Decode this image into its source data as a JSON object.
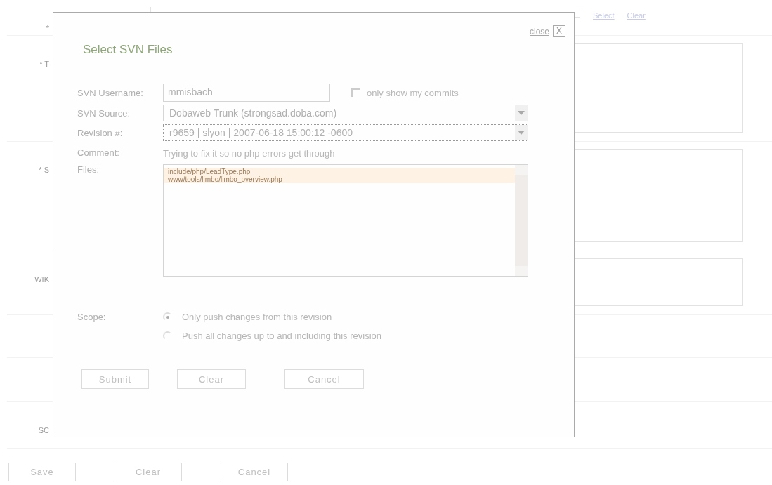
{
  "background_form": {
    "rows": [
      {
        "label": "*",
        "kind": "input",
        "links": [
          "Select",
          "Clear"
        ]
      },
      {
        "label": "* T",
        "kind": "textarea"
      },
      {
        "label": "* S",
        "kind": "textarea"
      },
      {
        "label": "WIK",
        "kind": "textarea"
      },
      {
        "kind": "empty"
      },
      {
        "kind": "empty"
      },
      {
        "label": "SC",
        "kind": "empty"
      }
    ],
    "buttons": [
      "Save",
      "Clear",
      "Cancel"
    ]
  },
  "dialog": {
    "close_label": "close",
    "close_button": "X",
    "title": "Select SVN Files",
    "username": {
      "label": "SVN Username:",
      "value": "mmisbach"
    },
    "only_mine": {
      "label": "only show my commits",
      "checked": false
    },
    "source": {
      "label": "SVN Source:",
      "value": "Dobaweb Trunk (strongsad.doba.com)"
    },
    "revision": {
      "label": "Revision #:",
      "value": "r9659 | slyon | 2007-06-18 15:00:12 -0600",
      "focused": true
    },
    "comment": {
      "label": "Comment:",
      "value": "Trying to fix it so no php errors get through"
    },
    "files": {
      "label": "Files:",
      "items": [
        {
          "text": "include/php/LeadType.php",
          "selected": true
        },
        {
          "text": "www/tools/limbo/limbo_overview.php",
          "selected": true
        }
      ]
    },
    "scope": {
      "label": "Scope:",
      "options": [
        {
          "label": "Only push changes from this revision",
          "selected": true
        },
        {
          "label": "Push all changes up to and including this revision",
          "selected": false
        }
      ]
    },
    "buttons": [
      "Submit",
      "Clear",
      "Cancel"
    ]
  }
}
